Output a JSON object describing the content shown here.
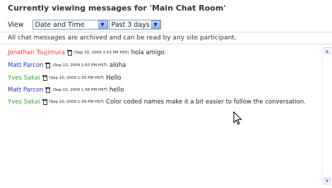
{
  "header": {
    "title": "Currently viewing messages for 'Main Chat Room'"
  },
  "view": {
    "label": "View",
    "sort_selected": "Date and Time",
    "range_selected": "Past 3 days"
  },
  "notice": "All chat messages are archived and can be read by any site participant.",
  "colors": {
    "red": "#ff3333",
    "blue": "#2233cc",
    "green": "#33a033"
  },
  "messages": [
    {
      "name": "Jonathan Tsujimura",
      "time": "(Sep 10, 2009 1:53 PM HST)",
      "text": "hola amigo",
      "color": "#ff3333"
    },
    {
      "name": "Matt Parcon",
      "time": "(Sep 10, 2009 1:55 PM HST)",
      "text": "aloha",
      "color": "#2233cc"
    },
    {
      "name": "Yves Sakai",
      "time": "(Sep 10, 2009 1:55 PM HST)",
      "text": "Hello",
      "color": "#33a033"
    },
    {
      "name": "Matt Parcon",
      "time": "(Sep 10, 2009 1:56 PM HST)",
      "text": "hello",
      "color": "#2233cc"
    },
    {
      "name": "Yves Sakai",
      "time": "(Sep 10, 2009 1:59 PM HST)",
      "text": "Color coded names make it a bit easier to follow the conversation.",
      "color": "#33a033"
    }
  ]
}
